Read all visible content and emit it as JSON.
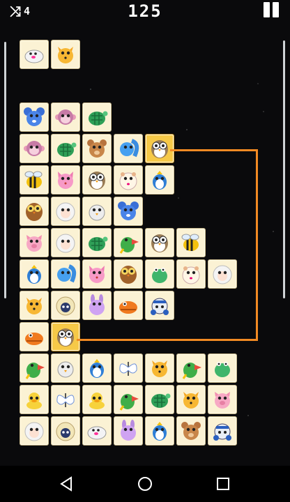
{
  "hud": {
    "shuffles": "4",
    "score": "125"
  },
  "colors": {
    "tile": "#fbf2d4",
    "tile_selected": "#f6c948",
    "path": "#f28a23",
    "background": "#0a0a0c"
  },
  "board": {
    "tiles": [
      {
        "row": 0,
        "col": 0,
        "animal": "seal"
      },
      {
        "row": 0,
        "col": 1,
        "animal": "fox"
      },
      {
        "row": 2,
        "col": 0,
        "animal": "mouse"
      },
      {
        "row": 2,
        "col": 1,
        "animal": "monkey"
      },
      {
        "row": 2,
        "col": 2,
        "animal": "turtle"
      },
      {
        "row": 3,
        "col": 0,
        "animal": "monkey"
      },
      {
        "row": 3,
        "col": 1,
        "animal": "turtle"
      },
      {
        "row": 3,
        "col": 2,
        "animal": "bear"
      },
      {
        "row": 3,
        "col": 3,
        "animal": "squirrel"
      },
      {
        "row": 3,
        "col": 4,
        "animal": "owl",
        "selected": true
      },
      {
        "row": 4,
        "col": 0,
        "animal": "bee"
      },
      {
        "row": 4,
        "col": 1,
        "animal": "cat"
      },
      {
        "row": 4,
        "col": 2,
        "animal": "owl"
      },
      {
        "row": 4,
        "col": 3,
        "animal": "hamster"
      },
      {
        "row": 4,
        "col": 4,
        "animal": "dino"
      },
      {
        "row": 5,
        "col": 0,
        "animal": "brown-owl"
      },
      {
        "row": 5,
        "col": 1,
        "animal": "sheep"
      },
      {
        "row": 5,
        "col": 2,
        "animal": "chick"
      },
      {
        "row": 5,
        "col": 3,
        "animal": "mouse"
      },
      {
        "row": 6,
        "col": 0,
        "animal": "pig"
      },
      {
        "row": 6,
        "col": 1,
        "animal": "sheep"
      },
      {
        "row": 6,
        "col": 2,
        "animal": "turtle"
      },
      {
        "row": 6,
        "col": 3,
        "animal": "parrot"
      },
      {
        "row": 6,
        "col": 4,
        "animal": "owl"
      },
      {
        "row": 6,
        "col": 5,
        "animal": "bee"
      },
      {
        "row": 7,
        "col": 0,
        "animal": "dino"
      },
      {
        "row": 7,
        "col": 1,
        "animal": "squirrel"
      },
      {
        "row": 7,
        "col": 2,
        "animal": "cat"
      },
      {
        "row": 7,
        "col": 3,
        "animal": "brown-owl"
      },
      {
        "row": 7,
        "col": 4,
        "animal": "crocodile"
      },
      {
        "row": 7,
        "col": 5,
        "animal": "hamster"
      },
      {
        "row": 7,
        "col": 6,
        "animal": "sheep"
      },
      {
        "row": 8,
        "col": 0,
        "animal": "fox"
      },
      {
        "row": 8,
        "col": 1,
        "animal": "black-sheep"
      },
      {
        "row": 8,
        "col": 2,
        "animal": "rabbit"
      },
      {
        "row": 8,
        "col": 3,
        "animal": "orange-dino"
      },
      {
        "row": 8,
        "col": 4,
        "animal": "crab"
      },
      {
        "row": 9,
        "col": 0,
        "animal": "orange-dino"
      },
      {
        "row": 9,
        "col": 1,
        "animal": "owl",
        "selected": true
      },
      {
        "row": 10,
        "col": 0,
        "animal": "parrot"
      },
      {
        "row": 10,
        "col": 1,
        "animal": "chick"
      },
      {
        "row": 10,
        "col": 2,
        "animal": "dino"
      },
      {
        "row": 10,
        "col": 3,
        "animal": "butterfly"
      },
      {
        "row": 10,
        "col": 4,
        "animal": "fox"
      },
      {
        "row": 10,
        "col": 5,
        "animal": "parrot"
      },
      {
        "row": 10,
        "col": 6,
        "animal": "crocodile"
      },
      {
        "row": 11,
        "col": 0,
        "animal": "duck"
      },
      {
        "row": 11,
        "col": 1,
        "animal": "butterfly"
      },
      {
        "row": 11,
        "col": 2,
        "animal": "duck"
      },
      {
        "row": 11,
        "col": 3,
        "animal": "parrot"
      },
      {
        "row": 11,
        "col": 4,
        "animal": "turtle"
      },
      {
        "row": 11,
        "col": 5,
        "animal": "fox"
      },
      {
        "row": 11,
        "col": 6,
        "animal": "pig"
      },
      {
        "row": 12,
        "col": 0,
        "animal": "sheep"
      },
      {
        "row": 12,
        "col": 1,
        "animal": "black-sheep"
      },
      {
        "row": 12,
        "col": 2,
        "animal": "seal"
      },
      {
        "row": 12,
        "col": 3,
        "animal": "rabbit"
      },
      {
        "row": 12,
        "col": 4,
        "animal": "dino"
      },
      {
        "row": 12,
        "col": 5,
        "animal": "bear"
      },
      {
        "row": 12,
        "col": 6,
        "animal": "crab"
      }
    ]
  },
  "nav": {
    "back": "back-icon",
    "home": "home-icon",
    "recents": "recents-icon"
  }
}
